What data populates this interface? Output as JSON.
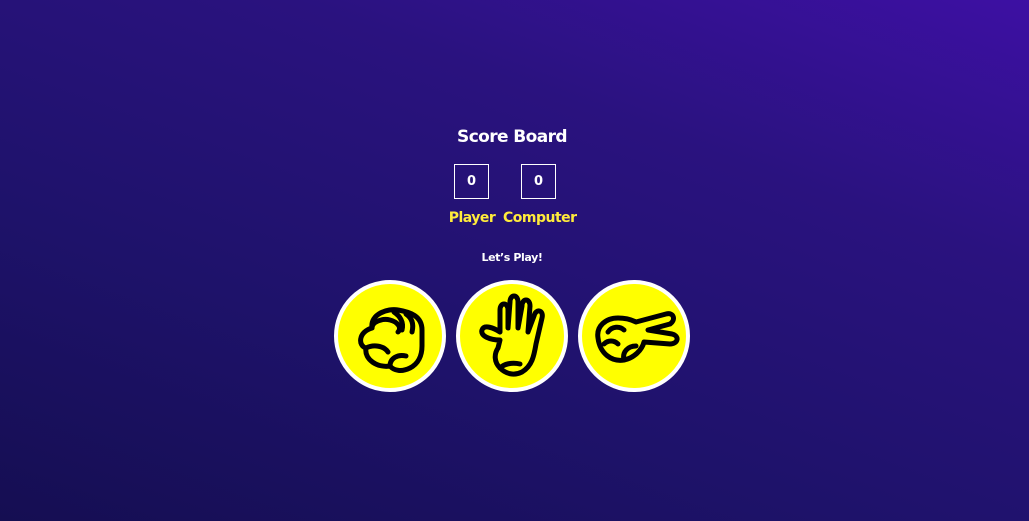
{
  "scoreboard": {
    "title": "Score Board",
    "player": {
      "score": "0",
      "label": "Player"
    },
    "computer": {
      "score": "0",
      "label": "Computer"
    }
  },
  "prompt": "Let’s Play!",
  "choices": [
    {
      "name": "rock",
      "icon": "fist-icon"
    },
    {
      "name": "paper",
      "icon": "open-hand-icon"
    },
    {
      "name": "scissors",
      "icon": "peace-hand-icon"
    }
  ],
  "colors": {
    "background_top": "#3d10a3",
    "background_bottom": "#150e52",
    "accent": "#ffeb3b",
    "choice_fill": "#ffff00",
    "choice_border": "#ffffff"
  }
}
